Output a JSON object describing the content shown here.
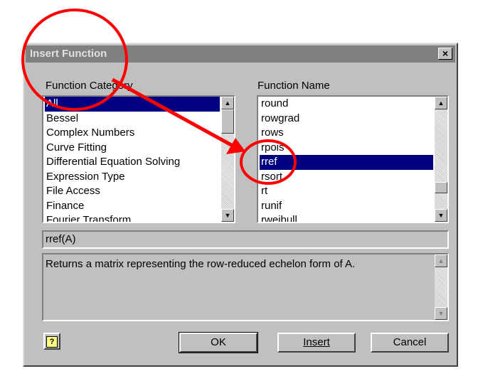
{
  "window": {
    "title": "Insert Function",
    "close_label": "×"
  },
  "category": {
    "label": "Function Category",
    "items": [
      "All",
      "Bessel",
      "Complex Numbers",
      "Curve Fitting",
      "Differential Equation Solving",
      "Expression Type",
      "File Access",
      "Finance",
      "Fourier Transform"
    ],
    "selected_index": 0
  },
  "function_name": {
    "label": "Function Name",
    "items": [
      "round",
      "rowgrad",
      "rows",
      "rpois",
      "rref",
      "rsort",
      "rt",
      "runif",
      "rweibull"
    ],
    "selected_index": 4
  },
  "signature": {
    "value": "rref(A)"
  },
  "description": {
    "value": "Returns a matrix representing the row-reduced echelon form of A."
  },
  "buttons": {
    "help": "?",
    "ok": "OK",
    "insert": "Insert",
    "cancel": "Cancel"
  },
  "scroll": {
    "up": "▲",
    "down": "▼"
  },
  "annotation": {
    "color": "#ff0000"
  }
}
